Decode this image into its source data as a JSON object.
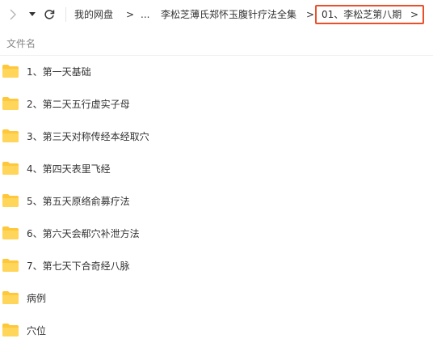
{
  "toolbar": {
    "breadcrumbs": [
      "我的网盘",
      "...",
      "李松芝薄氏郑怀玉腹针疗法全集"
    ],
    "separator": ">",
    "current": "01、李松芝第八期",
    "current_chevron": ">"
  },
  "header": {
    "column_name": "文件名"
  },
  "files": [
    {
      "name": "1、第一天基础",
      "icon": "folder-icon"
    },
    {
      "name": "2、第二天五行虚实子母",
      "icon": "folder-icon"
    },
    {
      "name": "3、第三天对称传经本经取穴",
      "icon": "folder-icon"
    },
    {
      "name": "4、第四天表里飞经",
      "icon": "folder-icon"
    },
    {
      "name": "5、第五天原络俞募疗法",
      "icon": "folder-icon"
    },
    {
      "name": "6、第六天会郗穴补泄方法",
      "icon": "folder-icon"
    },
    {
      "name": "7、第七天下合奇经八脉",
      "icon": "folder-icon"
    },
    {
      "name": "病例",
      "icon": "folder-icon"
    },
    {
      "name": "穴位",
      "icon": "folder-icon"
    }
  ],
  "colors": {
    "highlight_border": "#e8502a",
    "folder": "#ffc73a"
  }
}
